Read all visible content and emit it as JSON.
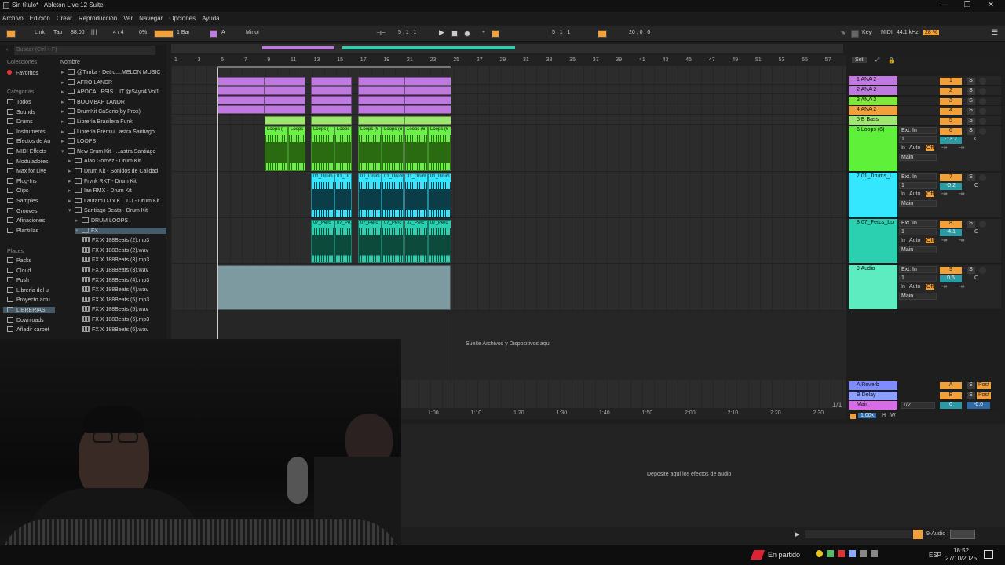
{
  "window": {
    "title": "Sin título* - Ableton Live 12 Suite",
    "minimize": "—",
    "restore": "❐",
    "close": "✕"
  },
  "menu": [
    "Archivo",
    "Edición",
    "Crear",
    "Reproducción",
    "Ver",
    "Navegar",
    "Opciones",
    "Ayuda"
  ],
  "control_bar": {
    "link": "Link",
    "tap": "Tap",
    "tempo": "88.00",
    "signature": "4 / 4",
    "swing": "0%",
    "quantize": "1 Bar",
    "key": "A",
    "scale": "Minor",
    "position": "5 . 1 . 1",
    "loop_start": "5 . 1 . 1",
    "loop_length": "20 . 0 . 0",
    "key_btn": "Key",
    "midi": "MIDI",
    "sample_rate": "44.1 kHz",
    "cpu": "28 %"
  },
  "browser": {
    "search_placeholder": "Buscar (Ctrl + F)",
    "col_header": "Nombre",
    "colecciones": "Colecciones",
    "favoritos": "Favoritos",
    "categorias": "Categorías",
    "categories": [
      "Todos",
      "Sounds",
      "Drums",
      "Instruments",
      "Efectos de Au",
      "MIDI Effects",
      "Moduladores",
      "Max for Live",
      "Plug-Ins",
      "Clips",
      "Samples",
      "Grooves",
      "Afinaciones",
      "Plantillas"
    ],
    "places_header": "Places",
    "places": [
      "Packs",
      "Cloud",
      "Push",
      "Librería del u",
      "Proyecto actu",
      "LIBRERIAS",
      "Downloads",
      "Añadir carpet"
    ],
    "files": [
      "@Timka - Detro....MELON MUSIC_",
      "AFRO LANDR",
      "APOCALIPSIS ...IT @S4yn4 Vol1",
      "BOOMBAP LANDR",
      "DrumKit CaSerio(by Prox)",
      "Librería Brasilera Funk",
      "Librería Premiu...astra Santiago",
      "LOOPS",
      "New Drum Kit - ...astra Santiago",
      "Alan Gomez - Drum Kit",
      "Drum Kit - Sonidos de Calidad",
      "Frvnk RKT - Drum Kit",
      "Ian RMX - Drum Kit",
      "Lautaro DJ x K... DJ - Drum Kit",
      "Santiago Beats - Drum Kit",
      "DRUM LOOPS",
      "FX",
      "FX X 188Beats (2).mp3",
      "FX X 188Beats (2).wav",
      "FX X 188Beats (3).mp3",
      "FX X 188Beats (3).wav",
      "FX X 188Beats (4).mp3",
      "FX X 188Beats (4).wav",
      "FX X 188Beats (5).mp3",
      "FX X 188Beats (5).wav",
      "FX X 188Beats (6).mp3",
      "FX X 188Beats (6).wav"
    ]
  },
  "ruler": {
    "set": "Set",
    "bars": [
      "1",
      "3",
      "5",
      "7",
      "9",
      "11",
      "13",
      "15",
      "17",
      "19",
      "21",
      "23",
      "25",
      "27",
      "29",
      "31",
      "33",
      "35",
      "37",
      "39",
      "41",
      "43",
      "45",
      "47",
      "49",
      "51",
      "53",
      "55",
      "57"
    ],
    "times": [
      "1:00",
      "1:10",
      "1:20",
      "1:30",
      "1:40",
      "1:50",
      "2:00",
      "2:10",
      "2:20",
      "2:30"
    ],
    "fraction": "1/1"
  },
  "clips": {
    "loops": "Loops (",
    "loops6": "Loops (6",
    "drums": "01_Drum",
    "drums_s": "01_Dr",
    "percs": "07_Perc",
    "percs_s": "07_Pe"
  },
  "drop_hint": "Suelte Archivos y Dispositivos aquí",
  "tracks": [
    {
      "name": "1 ANA 2",
      "num": "1",
      "color": "#c079e0"
    },
    {
      "name": "2 ANA 2",
      "num": "2",
      "color": "#c079e0"
    },
    {
      "name": "3 ANA 2",
      "num": "3",
      "color": "#7ee83c"
    },
    {
      "name": "4 ANA 2",
      "num": "4",
      "color": "#f2a03a"
    },
    {
      "name": "5 B Bass",
      "num": "5",
      "color": "#9ee870"
    },
    {
      "name": "6 Loops (6)",
      "num": "6",
      "color": "#5ff03a",
      "vol": "-13.7"
    },
    {
      "name": "7 01_Drums_L",
      "num": "7",
      "color": "#35e6ff",
      "vol": "-0.2"
    },
    {
      "name": "8 07_Percs_Lo",
      "num": "8",
      "color": "#2ad0b0",
      "vol": "-4.1"
    },
    {
      "name": "9 Audio",
      "num": "9",
      "color": "#5cecc0",
      "vol": "0.5"
    }
  ],
  "io": {
    "ext_in": "Ext. In",
    "ch": "1",
    "in": "In",
    "auto": "Auto",
    "off": "Off",
    "main": "Main",
    "inf": "-∞",
    "pan": "C",
    "s": "S"
  },
  "returns": [
    {
      "name": "A Reverb",
      "letter": "A"
    },
    {
      "name": "B Delay",
      "letter": "B"
    },
    {
      "name": "Main",
      "letter": "0",
      "extra": "1/2",
      "vol": "-6.0"
    }
  ],
  "post": "Post",
  "master_zoom": "1.00x",
  "hw": "H",
  "w": "W",
  "device_hint": "Deposite aquí los efectos de audio",
  "status": {
    "track": "9-Audio"
  },
  "taskbar": {
    "game": "En partido",
    "lang": "ESP",
    "time": "18:52",
    "date": "27/10/2025"
  }
}
